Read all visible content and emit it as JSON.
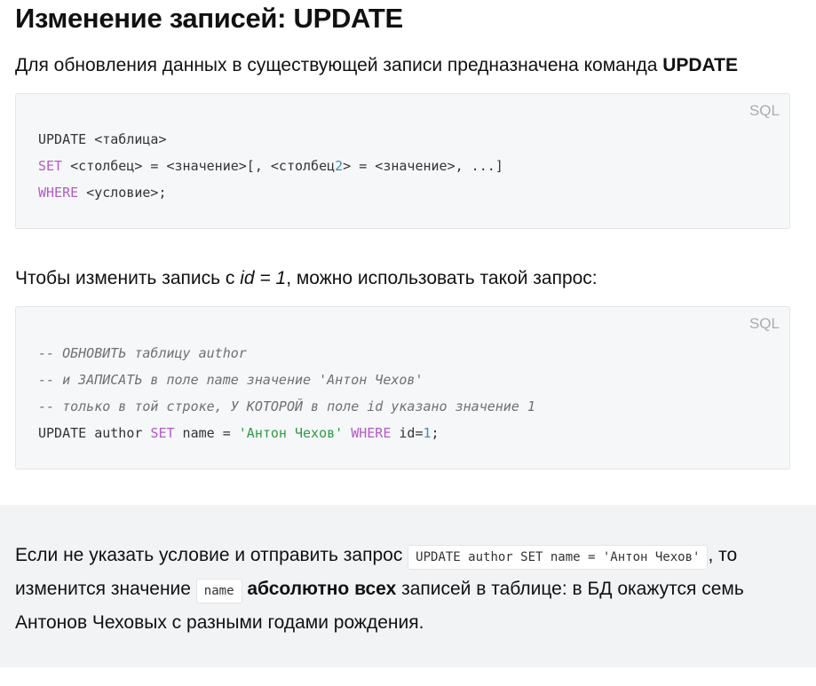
{
  "title": "Изменение записей: UPDATE",
  "intro": {
    "text": "Для обновления данных в существующей записи предназначена команда ",
    "keyword": "UPDATE"
  },
  "syntax_block": {
    "lang": "SQL",
    "line1": "UPDATE <таблица>",
    "line2_kw": "SET",
    "line2_a": " <столбец> = <значение>[, <столбец",
    "line2_num": "2",
    "line2_b": "> = <значение>, ...]",
    "line3_kw": "WHERE",
    "line3_rest": " <условие>;"
  },
  "para2": {
    "before": "Чтобы изменить запись с ",
    "italic": "id = 1",
    "after": ", можно использовать такой запрос:"
  },
  "example_block": {
    "lang": "SQL",
    "comment1": "-- ОБНОВИТЬ таблицу author",
    "comment2": "-- и ЗАПИСАТЬ в поле name значение 'Антон Чехов'",
    "comment3": "-- только в той строке, У КОТОРОЙ в поле id указано значение 1",
    "q_update": "UPDATE author ",
    "q_set": "SET",
    "q_name": " name = ",
    "q_str": "'Антон Чехов'",
    "q_sp": " ",
    "q_where": "WHERE",
    "q_id": " id=",
    "q_num": "1",
    "q_end": ";"
  },
  "note": {
    "text1": "Если не указать условие и отправить запрос ",
    "code1": "UPDATE author SET name = 'Антон Чехов'",
    "text2": ", то изменится значение ",
    "code2": "name",
    "text3": " ",
    "bold": "абсолютно всех",
    "text4": " записей в таблице: в БД окажутся семь Антонов Чеховых с разными годами рождения."
  }
}
